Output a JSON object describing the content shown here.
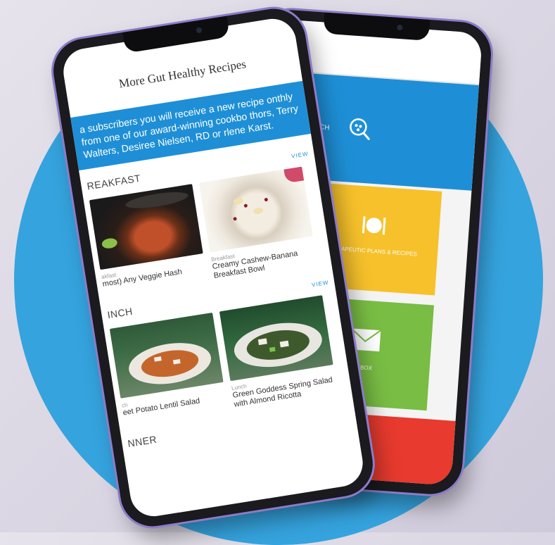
{
  "background": {
    "circle_color": "#35a3de",
    "frame_color": "#8d7bc7"
  },
  "back_phone": {
    "search_label": "FOOD SEARCH",
    "tiles": [
      {
        "label": "THERAPEUTIC PLANS & RECIPES",
        "color": "#f6c12b",
        "icon": "plate-cutlery-icon"
      },
      {
        "label": "INBOX",
        "color": "#79bd44",
        "icon": "envelope-icon"
      }
    ],
    "red_tile_color": "#e83a2e"
  },
  "front_phone": {
    "title": "More Gut Healthy Recipes",
    "banner": "a subscribers you will receive a new recipe onthly from one of our award-winning cookbo thors, Terry Walters, Desiree Nielsen, RD or rlene Karst.",
    "view_all": "VIEW",
    "sections": [
      {
        "title": "REAKFAST",
        "recipes": [
          {
            "category": "akfast",
            "name": "most) Any Veggie Hash"
          },
          {
            "category": "Breakfast",
            "name": "Creamy Cashew-Banana Breakfast Bowl"
          }
        ]
      },
      {
        "title": "INCH",
        "recipes": [
          {
            "category": "ch",
            "name": "eet Potato Lentil Salad"
          },
          {
            "category": "Lunch",
            "name": "Green Goddess Spring Salad with Almond Ricotta"
          }
        ]
      },
      {
        "title": "NNER"
      }
    ]
  }
}
